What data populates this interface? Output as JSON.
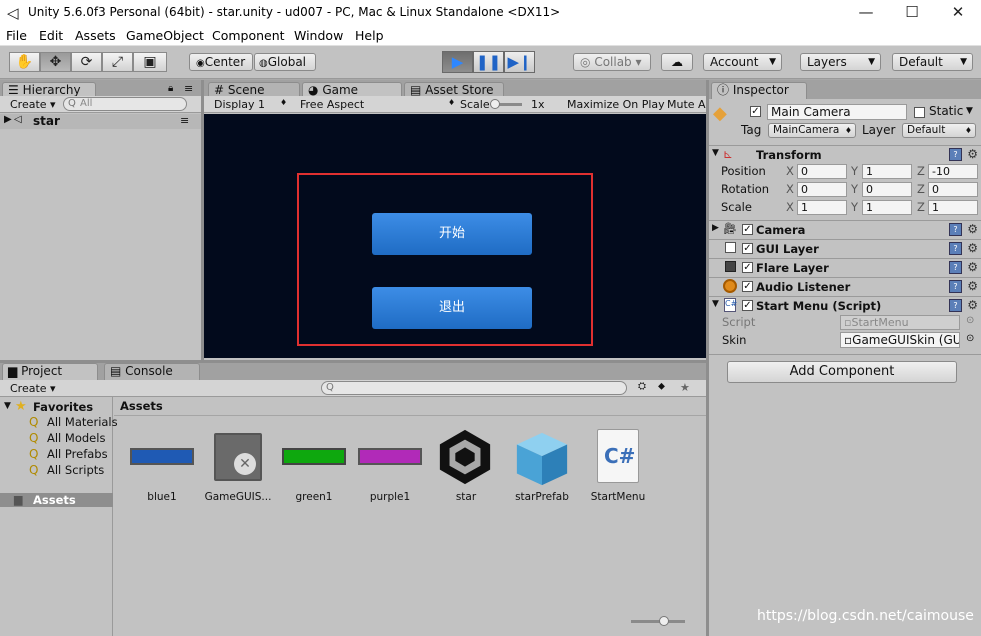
{
  "window": {
    "title": "Unity 5.6.0f3 Personal (64bit) - star.unity - ud007 - PC, Mac & Linux Standalone <DX11>",
    "minimize": "—",
    "maximize": "☐",
    "close": "✕"
  },
  "menu": [
    "File",
    "Edit",
    "Assets",
    "GameObject",
    "Component",
    "Window",
    "Help"
  ],
  "toolbar": {
    "pivot": "Center",
    "space": "Global",
    "collab": "Collab ▾",
    "account": "Account",
    "layers": "Layers",
    "layout": "Default"
  },
  "hierarchy": {
    "tab": "Hierarchy",
    "create": "Create ▾",
    "search_placeholder": "All",
    "scene": "star"
  },
  "center_tabs": {
    "scene": "Scene",
    "game": "Game",
    "store": "Asset Store"
  },
  "game_bar": {
    "display": "Display 1",
    "aspect": "Free Aspect",
    "scale_label": "Scale",
    "scale_value": "1x",
    "maximize": "Maximize On Play",
    "mute": "Mute A"
  },
  "game_view": {
    "start_button": "开始",
    "exit_button": "退出",
    "highlight_color": "#e03030"
  },
  "inspector": {
    "tab": "Inspector",
    "object_name": "Main Camera",
    "static_label": "Static",
    "tag_label": "Tag",
    "tag_value": "MainCamera",
    "layer_label": "Layer",
    "layer_value": "Default",
    "transform": {
      "name": "Transform",
      "rows": [
        {
          "label": "Position",
          "x": "0",
          "y": "1",
          "z": "-10"
        },
        {
          "label": "Rotation",
          "x": "0",
          "y": "0",
          "z": "0"
        },
        {
          "label": "Scale",
          "x": "1",
          "y": "1",
          "z": "1"
        }
      ]
    },
    "components": [
      "Camera",
      "GUI Layer",
      "Flare Layer",
      "Audio Listener",
      "Start Menu (Script)"
    ],
    "script_label": "Script",
    "script_value": "StartMenu",
    "skin_label": "Skin",
    "skin_value": "GameGUISkin (GU",
    "add_component": "Add Component"
  },
  "project": {
    "tab": "Project",
    "console_tab": "Console",
    "create": "Create ▾",
    "favorites": "Favorites",
    "fav_items": [
      "All Materials",
      "All Models",
      "All Prefabs",
      "All Scripts"
    ],
    "assets_folder": "Assets",
    "breadcrumb": "Assets",
    "assets": [
      "blue1",
      "GameGUIS...",
      "green1",
      "purple1",
      "star",
      "starPrefab",
      "StartMenu"
    ],
    "colors": {
      "blue1": "#1f5ab4",
      "green1": "#0ea80e",
      "purple1": "#b12ab8"
    }
  },
  "watermark": "https://blog.csdn.net/caimouse"
}
